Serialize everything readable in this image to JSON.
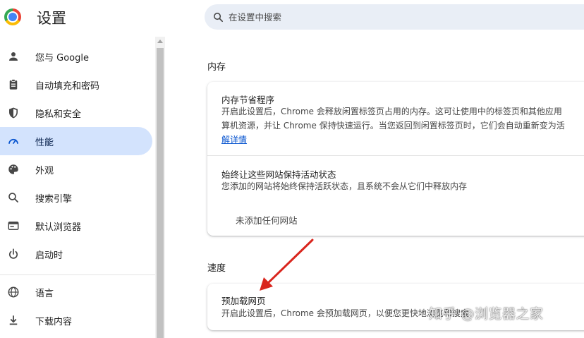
{
  "header": {
    "title": "设置",
    "search_placeholder": "在设置中搜索"
  },
  "sidebar": {
    "items": [
      {
        "label": "您与 Google",
        "icon": "person-icon"
      },
      {
        "label": "自动填充和密码",
        "icon": "clipboard-icon"
      },
      {
        "label": "隐私和安全",
        "icon": "shield-icon"
      },
      {
        "label": "性能",
        "icon": "speedometer-icon",
        "active": true
      },
      {
        "label": "外观",
        "icon": "palette-icon"
      },
      {
        "label": "搜索引擎",
        "icon": "search-icon"
      },
      {
        "label": "默认浏览器",
        "icon": "browser-icon"
      },
      {
        "label": "启动时",
        "icon": "power-icon"
      },
      {
        "label": "语言",
        "icon": "globe-icon"
      },
      {
        "label": "下载内容",
        "icon": "download-icon"
      }
    ]
  },
  "memory": {
    "section_title": "内存",
    "saver_title": "内存节省程序",
    "saver_desc_line1": "开启此设置后，Chrome 会释放闲置标签页占用的内存。这可让使用中的标签页和其他应用",
    "saver_desc_line2": "算机资源，并让 Chrome 保持快速运行。当您返回到闲置标签页时，它们会自动重新变为活",
    "saver_link": "解详情",
    "keep_active_title": "始终让这些网站保持活动状态",
    "keep_active_desc": "您添加的网站将始终保持活跃状态，且系统不会从它们中释放内存",
    "no_sites": "未添加任何网站"
  },
  "speed": {
    "section_title": "速度",
    "preload_title": "预加载网页",
    "preload_desc": "开启此设置后，Chrome 会预加载网页，以便您更快地浏览和搜索"
  },
  "watermark": "知乎 @浏览器之家",
  "colors": {
    "accent": "#0b57d0",
    "active_nav_bg": "#d3e3fd",
    "search_bg": "#e9eef6",
    "arrow": "#d9251d"
  }
}
